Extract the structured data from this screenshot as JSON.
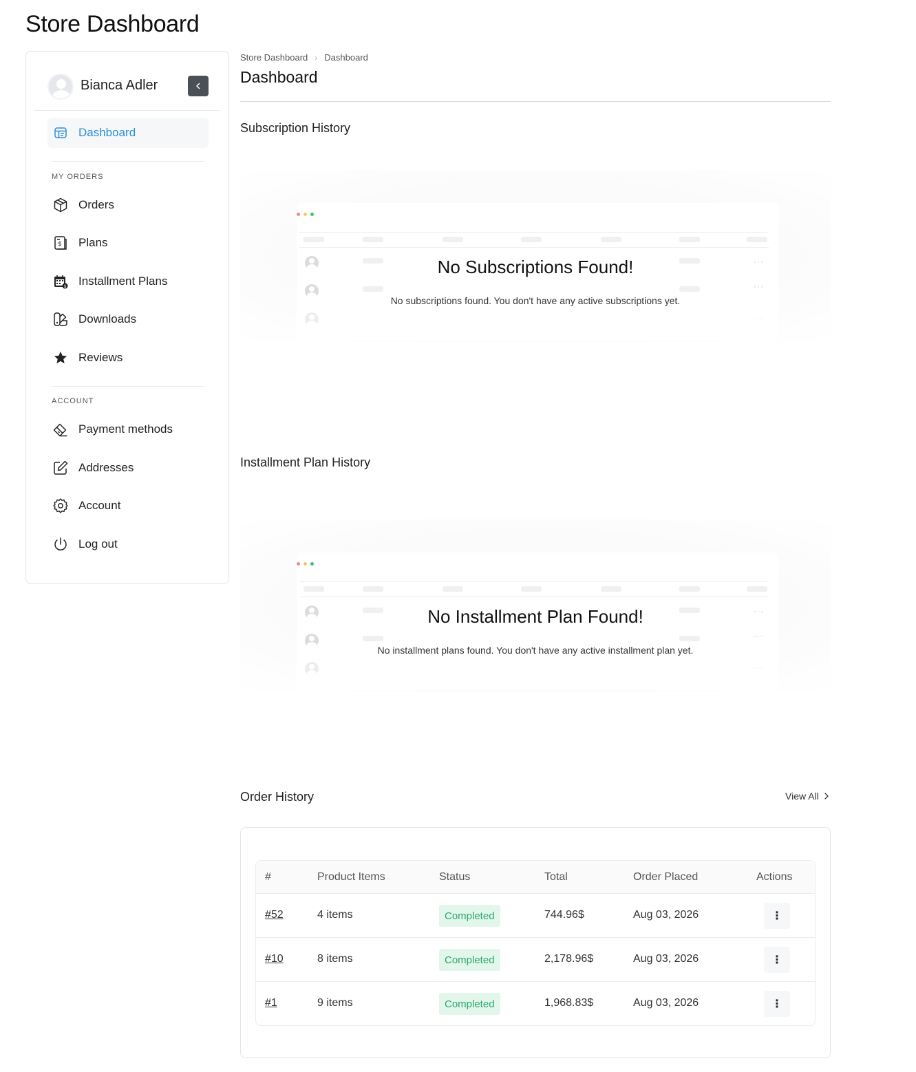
{
  "page": {
    "title": "Store Dashboard"
  },
  "sidebar": {
    "user_name": "Bianca Adler",
    "active_item": {
      "label": "Dashboard",
      "icon": "dashboard-icon"
    },
    "sections": [
      {
        "title": "MY ORDERS",
        "items": [
          {
            "label": "Orders",
            "icon": "box-icon"
          },
          {
            "label": "Plans",
            "icon": "plans-icon"
          },
          {
            "label": "Installment Plans",
            "icon": "calendar-icon"
          },
          {
            "label": "Downloads",
            "icon": "downloads-icon"
          },
          {
            "label": "Reviews",
            "icon": "star-icon"
          }
        ]
      },
      {
        "title": "ACCOUNT",
        "items": [
          {
            "label": "Payment methods",
            "icon": "payment-icon"
          },
          {
            "label": "Addresses",
            "icon": "edit-icon"
          },
          {
            "label": "Account",
            "icon": "gear-icon"
          },
          {
            "label": "Log out",
            "icon": "power-icon"
          }
        ]
      }
    ]
  },
  "breadcrumb": {
    "root": "Store Dashboard",
    "current": "Dashboard"
  },
  "main": {
    "title": "Dashboard",
    "subscription": {
      "heading": "Subscription History",
      "empty_title": "No Subscriptions Found!",
      "empty_text": "No subscriptions found. You don't have any active subscriptions yet."
    },
    "installment": {
      "heading": "Installment Plan History",
      "empty_title": "No Installment Plan Found!",
      "empty_text": "No installment plans found. You don't have any active installment plan yet."
    },
    "orders": {
      "heading": "Order History",
      "view_all": "View All",
      "columns": [
        "#",
        "Product Items",
        "Status",
        "Total",
        "Order Placed",
        "Actions"
      ],
      "rows": [
        {
          "id": "#52",
          "items": "4 items",
          "status": "Completed",
          "total": "744.96$",
          "placed": "Aug 03, 2026"
        },
        {
          "id": "#10",
          "items": "8 items",
          "status": "Completed",
          "total": "2,178.96$",
          "placed": "Aug 03, 2026"
        },
        {
          "id": "#1",
          "items": "9 items",
          "status": "Completed",
          "total": "1,968.83$",
          "placed": "Aug 03, 2026"
        }
      ]
    }
  },
  "colors": {
    "accent": "#2a8fd6",
    "success_bg": "#e3f6ec",
    "success_text": "#29a866",
    "dot_red": "#f08a8a",
    "dot_yellow": "#f2c96b",
    "dot_green": "#3cc07a"
  }
}
